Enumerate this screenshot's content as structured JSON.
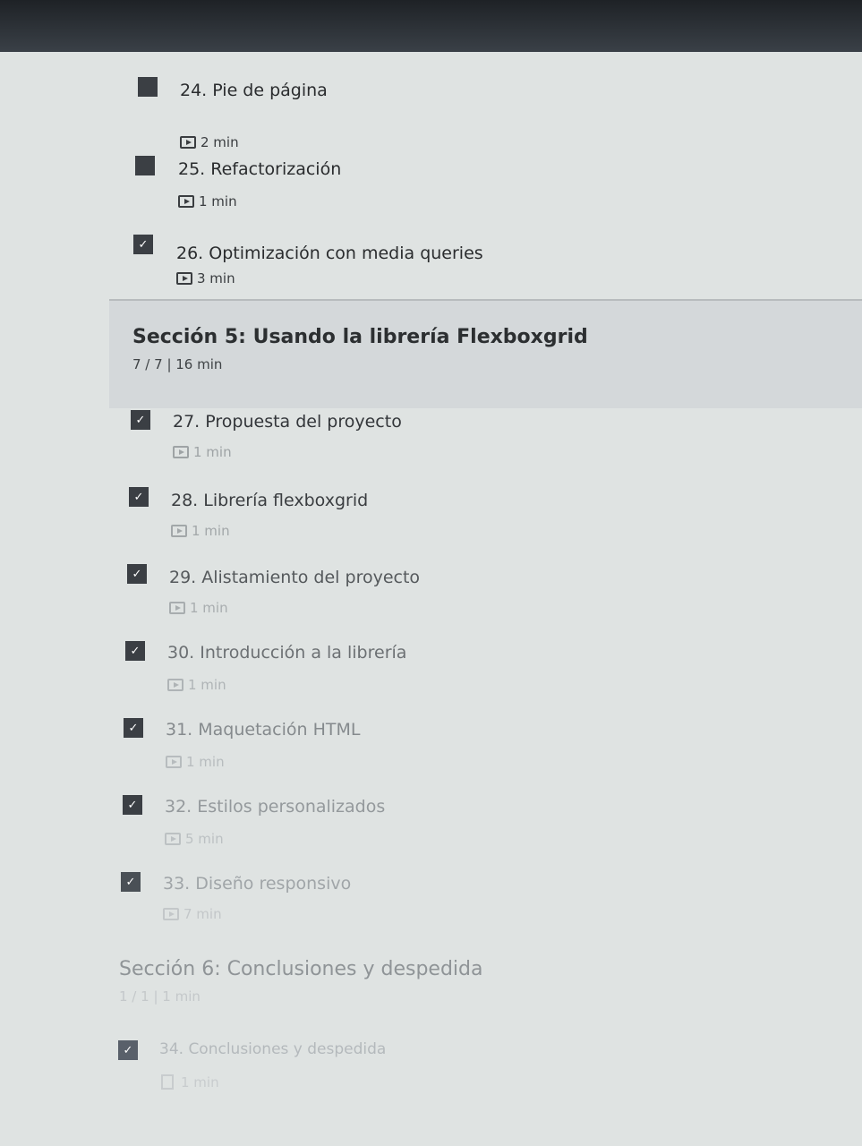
{
  "lectures_top": [
    {
      "title": "24. Pie de página",
      "duration": "2 min"
    },
    {
      "title": "25. Refactorización",
      "duration": "1 min"
    },
    {
      "title": "26. Optimización con media queries",
      "duration": "3 min"
    }
  ],
  "section5": {
    "title": "Sección 5: Usando la librería Flexboxgrid",
    "meta": "7 / 7 | 16 min",
    "lectures": [
      {
        "title": "27. Propuesta del proyecto",
        "duration": "1 min"
      },
      {
        "title": "28. Librería flexboxgrid",
        "duration": "1 min"
      },
      {
        "title": "29. Alistamiento del proyecto",
        "duration": "1 min"
      },
      {
        "title": "30. Introducción a la librería",
        "duration": "1 min"
      },
      {
        "title": "31. Maquetación HTML",
        "duration": "1 min"
      },
      {
        "title": "32. Estilos personalizados",
        "duration": "5 min"
      },
      {
        "title": "33. Diseño responsivo",
        "duration": "7 min"
      }
    ]
  },
  "section6": {
    "title": "Sección 6: Conclusiones y despedida",
    "meta": "1 / 1 | 1 min",
    "lectures": [
      {
        "title": "34. Conclusiones y despedida",
        "duration": "1 min"
      }
    ]
  },
  "check_glyph": "✓",
  "icons": {
    "video": "video-icon",
    "doc": "doc-icon",
    "check": "checkbox-icon"
  },
  "colors": {
    "background": "#dfe3e2",
    "section_band": "#d4d8da",
    "checkbox": "#3b3f44"
  }
}
